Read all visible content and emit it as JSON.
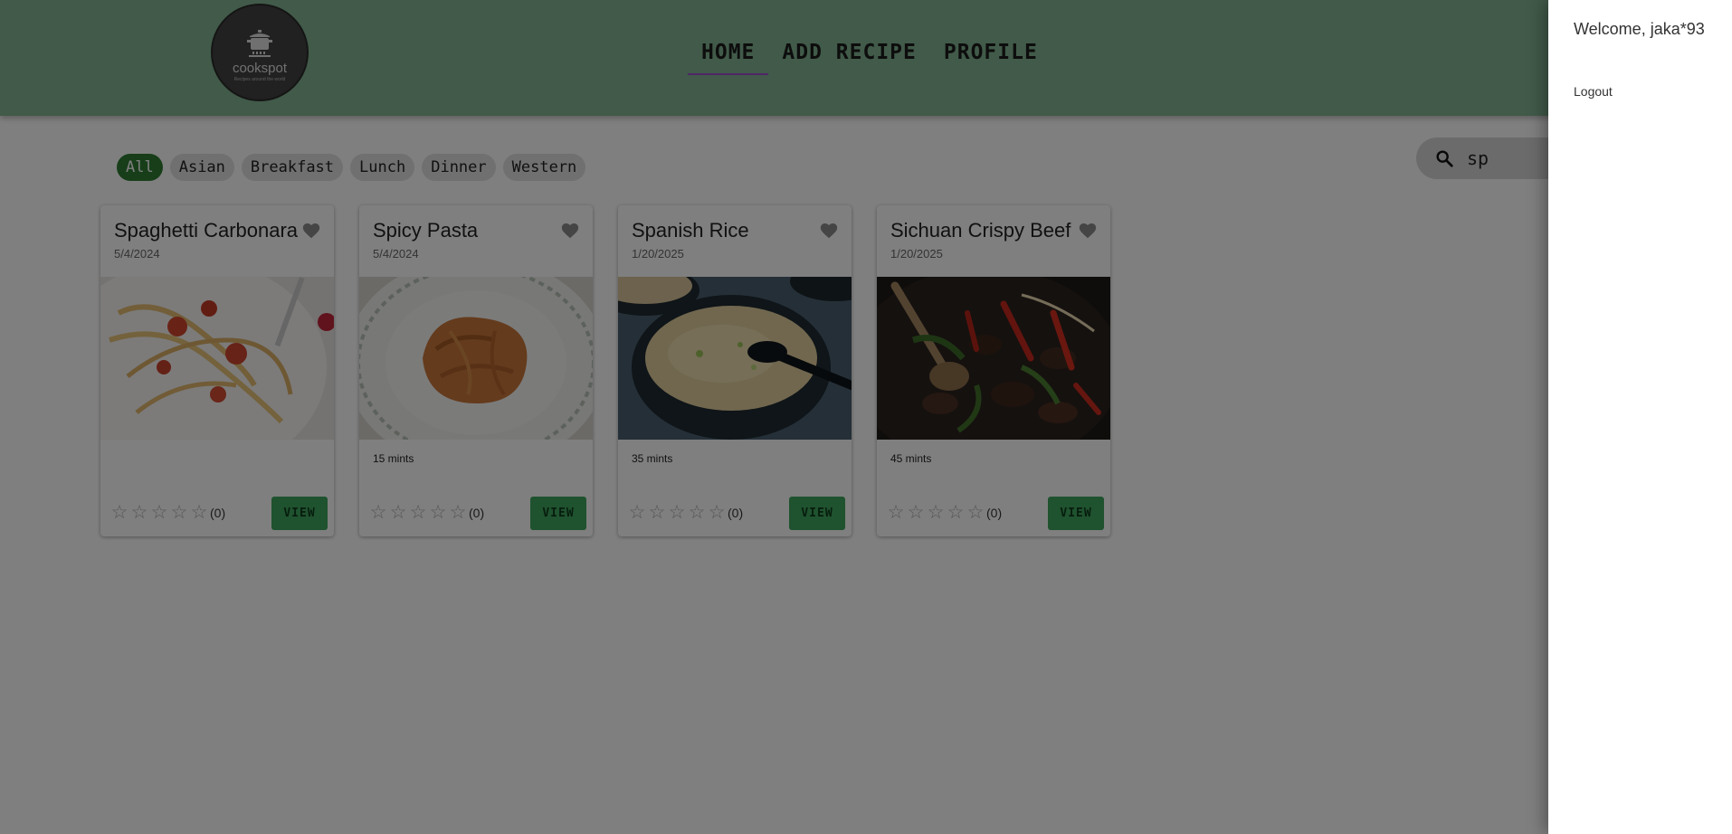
{
  "logo": {
    "name": "cookspot",
    "tagline": "Recipes around the world"
  },
  "nav": {
    "items": [
      {
        "label": "HOME",
        "active": true
      },
      {
        "label": "ADD RECIPE",
        "active": false
      },
      {
        "label": "PROFILE",
        "active": false
      }
    ]
  },
  "filters": {
    "items": [
      {
        "label": "All",
        "active": true
      },
      {
        "label": "Asian",
        "active": false
      },
      {
        "label": "Breakfast",
        "active": false
      },
      {
        "label": "Lunch",
        "active": false
      },
      {
        "label": "Dinner",
        "active": false
      },
      {
        "label": "Western",
        "active": false
      }
    ]
  },
  "search": {
    "value": "sp",
    "icon": "search-icon"
  },
  "recipes": [
    {
      "title": "Spaghetti Carbonara",
      "date": "5/4/2024",
      "time": "",
      "rating_count": "(0)",
      "rating": 0,
      "view_label": "VIEW",
      "image": "spaghetti-photo"
    },
    {
      "title": "Spicy Pasta",
      "date": "5/4/2024",
      "time": "15 mints",
      "rating_count": "(0)",
      "rating": 0,
      "view_label": "VIEW",
      "image": "pasta-photo"
    },
    {
      "title": "Spanish Rice",
      "date": "1/20/2025",
      "time": "35 mints",
      "rating_count": "(0)",
      "rating": 0,
      "view_label": "VIEW",
      "image": "rice-photo"
    },
    {
      "title": "Sichuan Crispy Beef",
      "date": "1/20/2025",
      "time": "45 mints",
      "rating_count": "(0)",
      "rating": 0,
      "view_label": "VIEW",
      "image": "beef-photo"
    }
  ],
  "drawer": {
    "welcome": "Welcome, jaka*93",
    "logout": "Logout"
  },
  "colors": {
    "header": "#83b592",
    "accent": "#2e7d32",
    "view_button": "#3ea55d",
    "nav_underline": "#9c4dcc"
  }
}
